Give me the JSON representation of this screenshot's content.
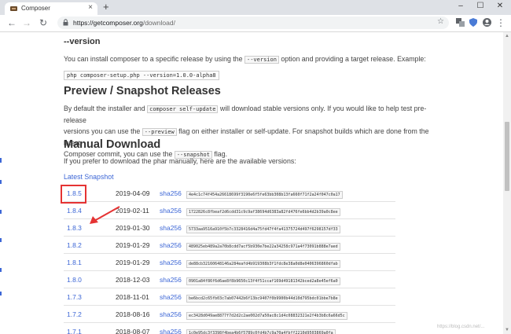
{
  "browser": {
    "tab_title": "Composer",
    "tab_close": "×",
    "new_tab": "+",
    "window_controls": [
      "–",
      "☐",
      "✕"
    ],
    "url_host": "https://getcomposer.org",
    "url_path": "/download/",
    "nav": {
      "back": "←",
      "forward": "→",
      "reload": "↻",
      "star": "☆",
      "menu": "⋮"
    },
    "extension_icons": [
      "translate-icon",
      "shield-icon",
      "profile-icon"
    ]
  },
  "page": {
    "version_heading": "--version",
    "version_text_before": "You can install composer to a specific release by using the ",
    "version_code": "--version",
    "version_text_after": " option and providing a target release. Example:",
    "version_example": "php composer-setup.php --version=1.0.0-alpha8",
    "preview_heading": "Preview / Snapshot Releases",
    "preview_p1": "By default the installer and ",
    "preview_code1": "composer self-update",
    "preview_p2": " will download stable versions only. If you would like to help test pre-release",
    "preview_p3": "versions you can use the ",
    "preview_code2": "--preview",
    "preview_p4": " flag on either installer or self-update. For snapshot builds which are done from the latest",
    "preview_p5": "Composer commit, you can use the ",
    "preview_code3": "--snapshot",
    "preview_p6": " flag.",
    "manual_heading": "Manual Download",
    "manual_text": "If you prefer to download the phar manually, here are the available versions:",
    "latest_snapshot": "Latest Snapshot",
    "releases": [
      {
        "version": "1.8.5",
        "date": "2019-04-09",
        "algo": "sha256",
        "hash": "4e4c1c74f454a26618699f3190e6f5fe63bb308b13fa660f71f2a24f047c0a17"
      },
      {
        "version": "1.8.4",
        "date": "2019-02-11",
        "algo": "sha256",
        "hash": "1722826c8fbeaf2d6cdd31c9c9af38694d6383a82fd476fe6bb4d2b39a0c8ee"
      },
      {
        "version": "1.8.3",
        "date": "2019-01-30",
        "algo": "sha256",
        "hash": "5733aa9516a910f5b7c3328416d4a75fd47f4fa41375724d497f6298157df33"
      },
      {
        "version": "1.8.2",
        "date": "2019-01-29",
        "algo": "sha256",
        "hash": "489025eb489a2a70b8cdd7acf5b930e7be22a34258c971a4f73091b888e7aed"
      },
      {
        "version": "1.8.1",
        "date": "2019-01-29",
        "algo": "sha256",
        "hash": "de88cb32160648146a284eafd4b919308b3f1fdc8e38a0d8e0406396860dfab"
      },
      {
        "version": "1.8.0",
        "date": "2018-12-03",
        "algo": "sha256",
        "hash": "0901a84f86f6d6ae8f8b9650c13f4f51ccaf169d49181342bced2a8e45ef6a0"
      },
      {
        "version": "1.7.3",
        "date": "2018-11-01",
        "algo": "sha256",
        "hash": "be6bcd2c65fb03c7ab07442b6f13bc9407f0b9900b44d10d795bdc01bbe7b8e"
      },
      {
        "version": "1.7.2",
        "date": "2018-08-16",
        "algo": "sha256",
        "hash": "ec3428d049ae8877f7d2d2c2ae002d7a50ac8c1d4c08832321e2f4b3b8c6a66d5c"
      },
      {
        "version": "1.7.1",
        "date": "2018-08-07",
        "algo": "sha256",
        "hash": "1c0e95dc3f3398f4bea4b6f5789c0fd4b7c9a70a4fbff2210d9503869a0fa"
      }
    ],
    "watermark": "https://blog.csdn.net/..."
  },
  "colors": {
    "link": "#3d67d6",
    "highlight": "#e53333"
  }
}
